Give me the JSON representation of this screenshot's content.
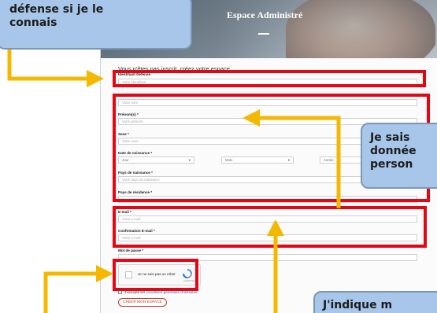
{
  "banner": {
    "title": "Espace Administré"
  },
  "form": {
    "intro": "Vous n'êtes pas inscrit, créez votre espace",
    "identifiant": {
      "label": "Identifiant Défense",
      "placeholder": "Votre identifiant"
    },
    "nom": {
      "placeholder": "Votre nom"
    },
    "prenom": {
      "label": "Prénom(s) *",
      "placeholder": "Votre prénom"
    },
    "sexe": {
      "label": "Sexe *",
      "placeholder": "Votre sexe"
    },
    "naissance": {
      "label": "Date de naissance *",
      "day": "Jour",
      "month": "Mois",
      "year": "Année"
    },
    "pays_naissance": {
      "label": "Pays de naissance *",
      "placeholder": "Votre pays de naissance"
    },
    "pays_residence": {
      "label": "Pays de résidence *"
    },
    "email": {
      "label": "E-mail *",
      "placeholder": "Votre e-mail"
    },
    "email_confirm": {
      "label": "Confirmation E-mail *",
      "placeholder": "Votre e-mail"
    },
    "password": {
      "label": "Mot de passe *"
    },
    "captcha": {
      "text": "Je ne suis pas un robot",
      "footer": "reCAPTCHA"
    },
    "cgu": {
      "prefix": "J'accepte les",
      "link": "conditions générales d'utilisation"
    },
    "create_button": "CRÉER MON ESPACE"
  },
  "callouts": {
    "top_left": [
      "défense si je le",
      "connais"
    ],
    "right": [
      "Je sais",
      "donnée",
      "person"
    ],
    "bottom_right": "J'indique m"
  },
  "colors": {
    "highlight": "#e30613",
    "arrow": "#f5b800",
    "callout_bg": "#a7c6ea",
    "button": "#c0392b"
  }
}
